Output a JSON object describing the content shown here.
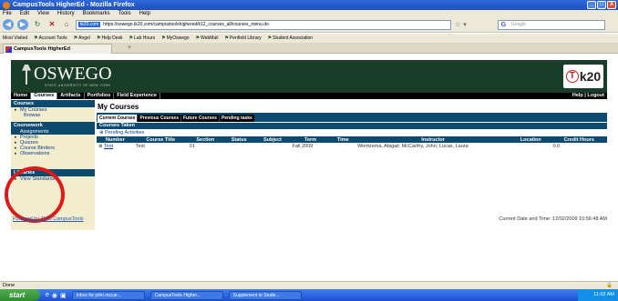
{
  "window": {
    "title": "CampusTools HigherEd - Mozilla Firefox",
    "controls": [
      "_",
      "□",
      "X"
    ]
  },
  "menubar": [
    "File",
    "Edit",
    "View",
    "History",
    "Bookmarks",
    "Tools",
    "Help"
  ],
  "navbar": {
    "site_badge": "tk20.com",
    "url": "https://oswego.tk20.com/campustoolshighered/k12_courses_all/courses_menu.do",
    "search_placeholder": "Google"
  },
  "bookmarks": [
    "Most Visited",
    "Account Tools",
    "Angel",
    "Help Desk",
    "Lab Hours",
    "MyOswego",
    "WebMail",
    "Penfield Library",
    "Student Association"
  ],
  "browser_tab": {
    "label": "CampusTools HigherEd",
    "new_tab": "+"
  },
  "header": {
    "logo_text": "OSWEGO",
    "logo_subtitle": "STATE UNIVERSITY OF NEW YORK",
    "brand": "Tk20",
    "brand_t": "T",
    "brand_rest": "k20"
  },
  "topnav": {
    "items": [
      "Home",
      "Courses",
      "Artifacts",
      "Portfolios",
      "Field Experience"
    ],
    "right": "Help | Logout"
  },
  "sidebar": {
    "courses_head": "Courses",
    "courses_items": [
      "My Courses"
    ],
    "courses_sub": [
      "Browse"
    ],
    "coursework_head": "Coursework",
    "coursework_items": [
      "Assignments",
      "Projects",
      "Quizzes",
      "Course Binders",
      "Observations"
    ],
    "libraries_head": "Libraries",
    "libraries_items": [
      "View Standards"
    ]
  },
  "main": {
    "title": "My Courses",
    "tabs": [
      "Current Courses",
      "Previous Courses",
      "Future Courses",
      "Pending tasks"
    ],
    "courses_taken": "Courses Taken",
    "pending_activities": "Pending Activities",
    "columns": [
      "Number",
      "Course Title",
      "Section",
      "Status",
      "Subject",
      "Term",
      "Time",
      "Instructor",
      "Location",
      "Credit Hours"
    ],
    "rows": [
      {
        "number": "Test",
        "course_title": "Test",
        "section": "01",
        "status": "",
        "subject": "",
        "term": "Fall 2009",
        "time": "",
        "instructor": "Wiertzema, Abigail; McCarthy, John; Lucas, Laura",
        "location": "",
        "credit_hours": "0.0"
      }
    ]
  },
  "footer": {
    "powered": "Powered by Tk20 CampusTools",
    "datetime": "Current Date and Time: 12/02/2009 10:56:48 AM"
  },
  "statusbar": {
    "text": "Done"
  },
  "taskbar": {
    "start": "start",
    "items": [
      "Inbox for john.mccar...",
      "CampusTools Higher...",
      "Supplement to Stude..."
    ],
    "clock": "11:02 AM"
  }
}
